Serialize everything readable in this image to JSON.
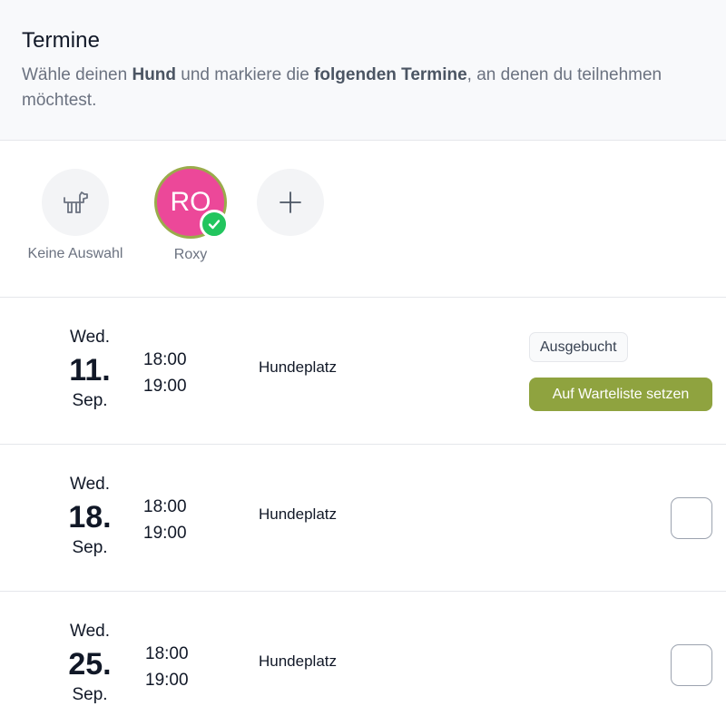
{
  "header": {
    "title": "Termine",
    "desc_1": "Wähle deinen ",
    "desc_bold_1": "Hund",
    "desc_2": " und markiere die ",
    "desc_bold_2": "folgenden Termine",
    "desc_3": ", an denen du teilnehmen möchtest."
  },
  "dogs": {
    "none": {
      "label": "Keine Auswahl",
      "icon": "dog-icon"
    },
    "roxy": {
      "initials": "RO",
      "label": "Roxy",
      "selected": true,
      "color": "#ec4899",
      "ring_color": "#9aab4b"
    },
    "add": {
      "icon": "plus-icon"
    }
  },
  "appointments": [
    {
      "weekday": "Wed.",
      "day": "11.",
      "month": "Sep.",
      "start": "18:00",
      "end": "19:00",
      "location": "Hundeplatz",
      "status": "Ausgebucht",
      "action": "Auf Warteliste setzen"
    },
    {
      "weekday": "Wed.",
      "day": "18.",
      "month": "Sep.",
      "start": "18:00",
      "end": "19:00",
      "location": "Hundeplatz",
      "checked": false
    },
    {
      "weekday": "Wed.",
      "day": "25.",
      "month": "Sep.",
      "start": "18:00",
      "end": "19:00",
      "location": "Hundeplatz",
      "checked": false
    }
  ],
  "colors": {
    "accent": "#8fa33f",
    "success": "#22c55e"
  }
}
